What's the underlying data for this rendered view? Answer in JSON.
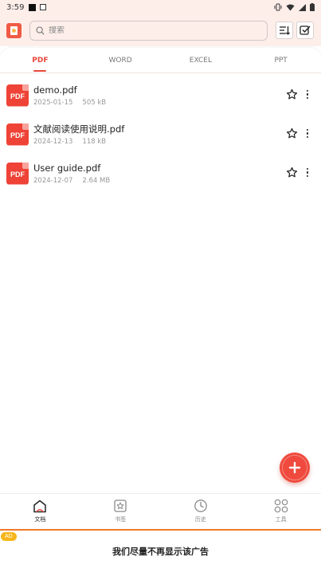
{
  "status_bar": {
    "time": "3:59",
    "icons": [
      "notification-square-icon",
      "notification-a-icon",
      "vibrate-icon",
      "wifi-icon",
      "signal-icon",
      "battery-icon"
    ]
  },
  "header": {
    "logo_icon": "app-logo-icon",
    "search_placeholder": "搜索",
    "sort_icon": "sort-icon",
    "select_icon": "multi-select-icon"
  },
  "tabs": [
    {
      "label": "PDF",
      "active": true
    },
    {
      "label": "WORD",
      "active": false
    },
    {
      "label": "EXCEL",
      "active": false
    },
    {
      "label": "PPT",
      "active": false
    }
  ],
  "files": [
    {
      "type_label": "PDF",
      "name": "demo.pdf",
      "date": "2025-01-15",
      "size": "505 kB"
    },
    {
      "type_label": "PDF",
      "name": "文献阅读使用说明.pdf",
      "date": "2024-12-13",
      "size": "118 kB"
    },
    {
      "type_label": "PDF",
      "name": "User guide.pdf",
      "date": "2024-12-07",
      "size": "2.64 MB"
    }
  ],
  "fab": {
    "icon": "plus-icon"
  },
  "bottom_nav": [
    {
      "label": "文档",
      "icon": "home-icon",
      "active": true
    },
    {
      "label": "书签",
      "icon": "bookmark-star-icon",
      "active": false
    },
    {
      "label": "历史",
      "icon": "clock-icon",
      "active": false
    },
    {
      "label": "工具",
      "icon": "tools-grid-icon",
      "active": false
    }
  ],
  "ad": {
    "tag": "AD",
    "text": "我们尽量不再显示该广告"
  },
  "colors": {
    "accent": "#e8473a",
    "header_bg": "#fdeeea",
    "pdf_red": "#ee4336",
    "ad_tag": "#f6b51a"
  }
}
